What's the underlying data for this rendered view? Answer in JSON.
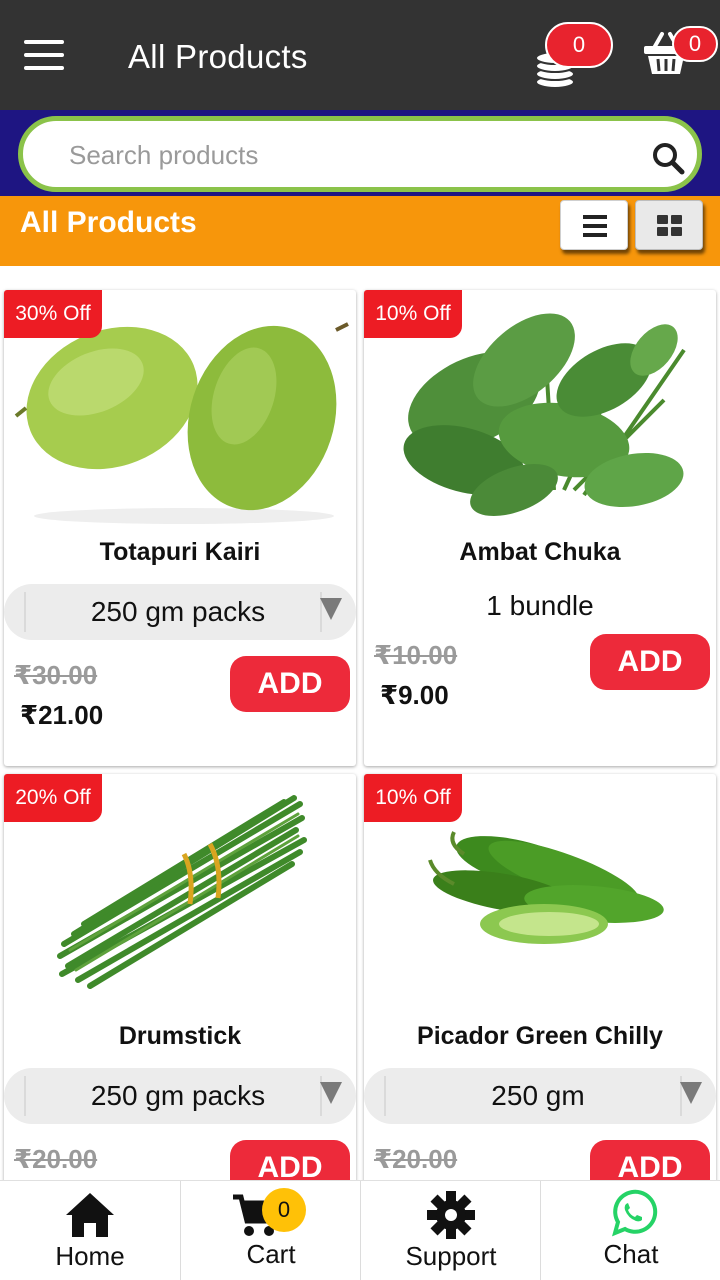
{
  "header": {
    "title": "All Products",
    "wallet_count": "0",
    "cart_count": "0"
  },
  "search": {
    "placeholder": "Search products"
  },
  "section": {
    "title": "All Products"
  },
  "products": [
    {
      "discount": "30% Off",
      "name": "Totapuri Kairi",
      "unit": "250 gm packs",
      "unit_is_select": true,
      "mrp": "₹30.00",
      "price": "₹21.00",
      "add_label": "ADD",
      "image": "green-mango-image"
    },
    {
      "discount": "10% Off",
      "name": "Ambat Chuka",
      "unit": "1 bundle",
      "unit_is_select": false,
      "mrp": "₹10.00",
      "price": "₹9.00",
      "add_label": "ADD",
      "image": "leafy-greens-image"
    },
    {
      "discount": "20% Off",
      "name": "Drumstick",
      "unit": "250 gm packs",
      "unit_is_select": true,
      "mrp": "₹20.00",
      "add_label": "ADD",
      "image": "drumstick-bundle-image"
    },
    {
      "discount": "10% Off",
      "name": "Picador Green Chilly",
      "unit": "250 gm",
      "unit_is_select": true,
      "mrp": "₹20.00",
      "add_label": "ADD",
      "image": "green-chilly-image"
    }
  ],
  "bottom_nav": {
    "home": "Home",
    "cart": "Cart",
    "cart_count": "0",
    "support": "Support",
    "chat": "Chat"
  },
  "colors": {
    "topbar": "#333333",
    "search_strip": "#1e1582",
    "search_border": "#8bc34a",
    "section_bar": "#f7960b",
    "badge_red": "#ed1c24",
    "add_button": "#ed2a3a",
    "cart_badge": "#ffc107",
    "whatsapp": "#25d366"
  }
}
